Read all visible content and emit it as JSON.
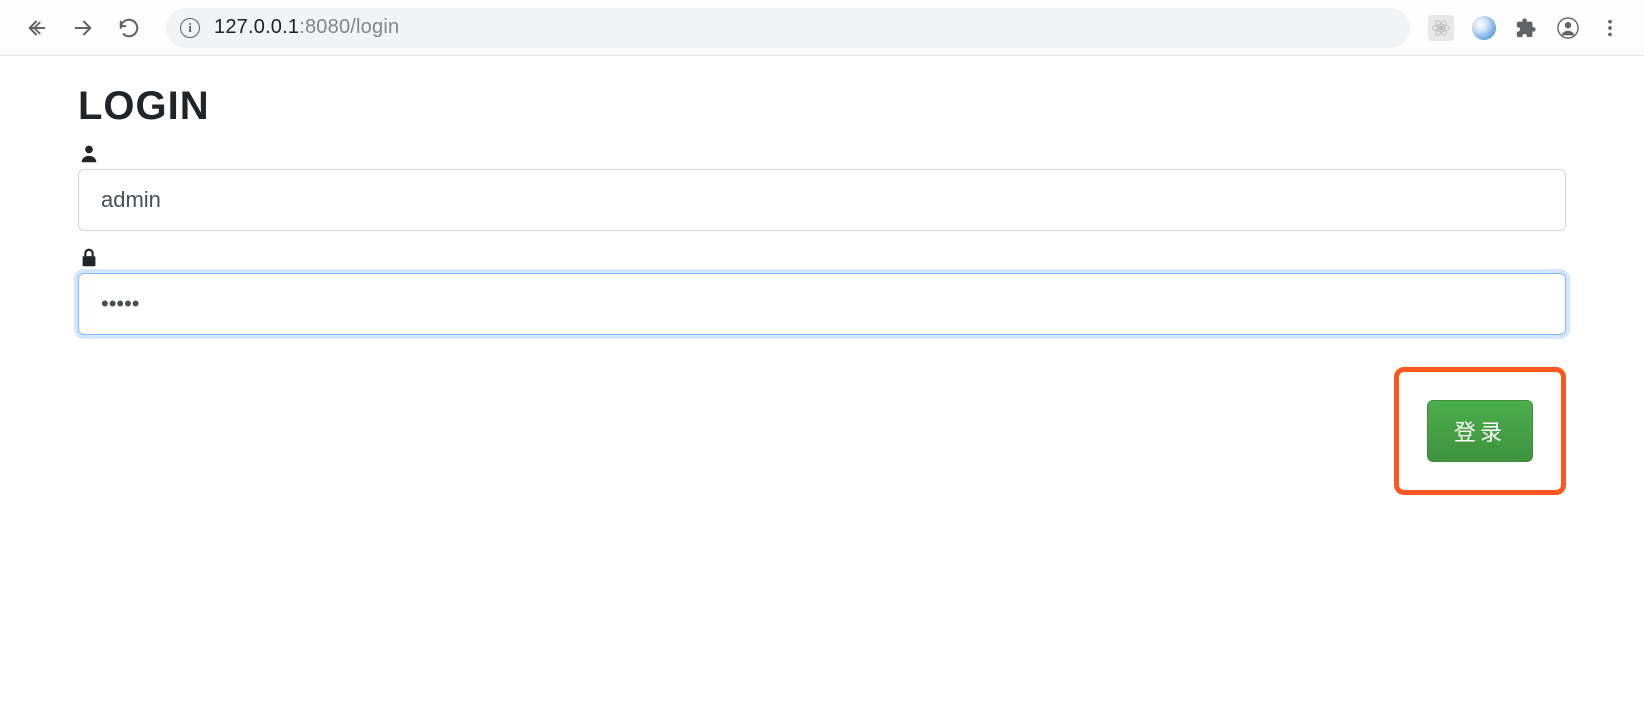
{
  "browser": {
    "url_host_dark": "127.0.0.1",
    "url_host_light": ":8080/login",
    "icons": {
      "back": "back-arrow-icon",
      "forward": "forward-arrow-icon",
      "reload": "reload-icon",
      "info": "i",
      "key": "key-icon",
      "star": "star-icon",
      "react": "react-devtools-icon",
      "opera": "opera-icon",
      "puzzle": "extensions-icon",
      "profile": "profile-icon",
      "menu": "more-menu-icon"
    }
  },
  "page": {
    "title": "LOGIN",
    "username": {
      "value": "admin",
      "icon": "user-icon"
    },
    "password": {
      "value": "•••••",
      "icon": "lock-icon"
    },
    "submit_label": "登录",
    "highlight_color": "#ff5722",
    "submit_color": "#449d44"
  }
}
